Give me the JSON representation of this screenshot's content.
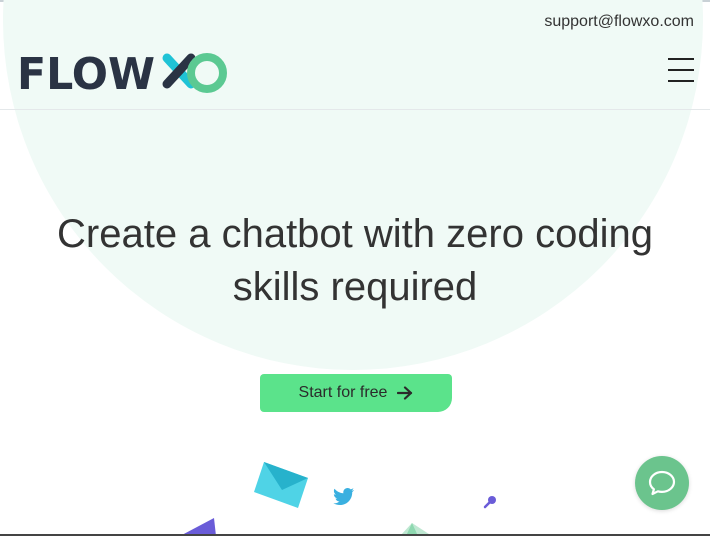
{
  "header": {
    "support_email": "support@flowxo.com",
    "logo_text": "FLOW",
    "menu_icon": "hamburger-menu-icon"
  },
  "hero": {
    "headline_line1": "Create a chatbot with zero coding",
    "headline_line2": "skills required",
    "cta_label": "Start for free",
    "cta_icon": "arrow-right-icon"
  },
  "chat_widget": {
    "icon": "chat-bubble-icon"
  },
  "colors": {
    "brand_dark": "#2a3344",
    "brand_teal": "#1fc3d6",
    "brand_green": "#5bc992",
    "cta_green": "#5be38b",
    "hero_bg": "#f0faf6",
    "chat_green": "#6bc48d"
  }
}
